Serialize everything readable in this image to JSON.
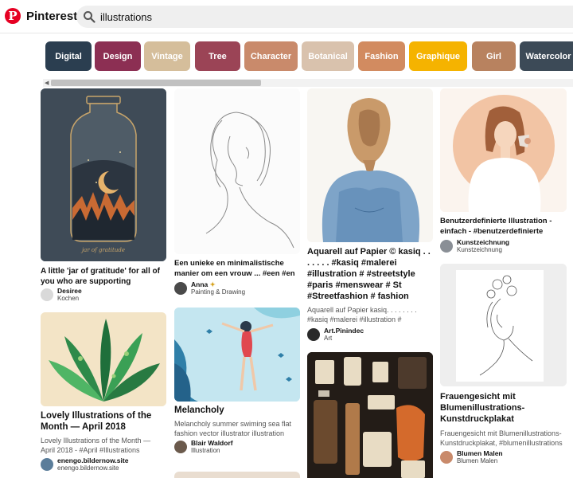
{
  "header": {
    "brand": "Pinterest",
    "search_value": "illustrations"
  },
  "chips": [
    {
      "label": "Digital",
      "color": "#2b3e50"
    },
    {
      "label": "Design",
      "color": "#8c2f53"
    },
    {
      "label": "Vintage",
      "color": "#d5be9b"
    },
    {
      "label": "Tree",
      "color": "#9b4456"
    },
    {
      "label": "Character",
      "color": "#c98a6b"
    },
    {
      "label": "Botanical",
      "color": "#d9c2ad"
    },
    {
      "label": "Fashion",
      "color": "#d28b60"
    },
    {
      "label": "Graphique",
      "color": "#f5b300"
    },
    {
      "label": "Girl",
      "color": "#b8825f"
    },
    {
      "label": "Watercolor",
      "color": "#3c4a57"
    }
  ],
  "pins": [
    {
      "title": "A little 'jar of gratitude' for all of you who are supporting independent...",
      "user": "Desiree",
      "board": "Kochen",
      "jar_text": "jar of gratitude"
    },
    {
      "title": "Lovely Illustrations of the Month — April 2018",
      "desc": "Lovely Illustrations of the Month — April 2018 - #April #Illustrations #Lovely",
      "user": "enengo.bildernow.site",
      "board": "enengo.bildernow.site"
    },
    {
      "title": "Een unieke en minimalistische manier om een vrouw ... #een #en #manier...",
      "user": "Anna",
      "board": "Painting & Drawing"
    },
    {
      "title": "Melancholy",
      "desc": "Melancholy summer swiming sea flat fashion vector illustrator illustration",
      "user": "Blair Waldorf",
      "board": "Illustration"
    },
    {
      "title": "Aquarell auf Papier © kasiq . . . . . . . #kasiq #malerei #illustration # #streetstyle #paris #menswear # St #Streetfashion # fashion",
      "desc": "Aquarell auf Papier kasiq. . . . . . . . #kasiq #malerei #illustration # #streetstyle...",
      "user": "Art.Pinindec",
      "board": "Art"
    },
    {
      "title": "Benutzerdefinierte Illustration - einfach - #benutzerdefinierte #einfa...",
      "user": "Kunstzeichnung",
      "board": "Kunstzeichnung"
    },
    {
      "title": "Frauengesicht mit Blumenillustrations-Kunstdruckplakat",
      "desc": "Frauengesicht mit Blumenillustrations-Kunstdruckplakat, #blumenillustrations",
      "user": "Blumen Malen",
      "board": "Blumen Malen"
    }
  ]
}
